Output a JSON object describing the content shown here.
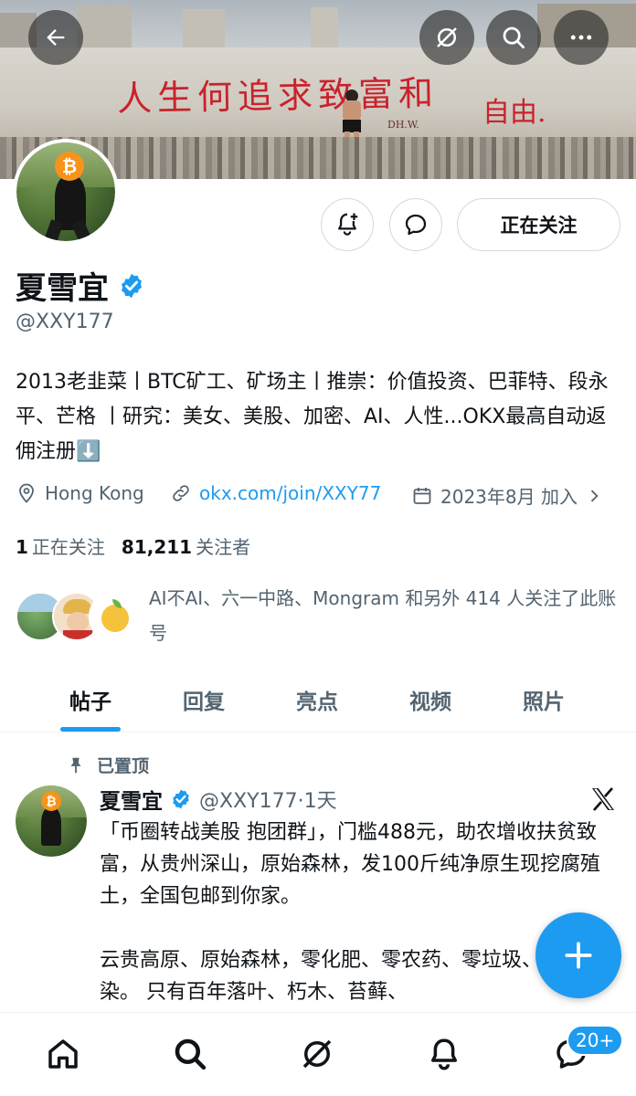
{
  "banner": {
    "slogan": "人生何追求致富和",
    "slogan_end": "自由.",
    "signature": "DH.W."
  },
  "header_icons": [
    "back-arrow-icon",
    "grok-icon",
    "search-icon",
    "more-icon"
  ],
  "profile": {
    "name": "夏雪宜",
    "handle": "@XXY177",
    "verified": true,
    "follow_button": "正在关注",
    "bio": "2013老韭菜丨BTC矿工、矿场主丨推崇：价值投资、巴菲特、段永平、芒格 丨研究：美女、美股、加密、AI、人性...OKX最高自动返佣注册⬇️",
    "location": "Hong Kong",
    "link": "okx.com/join/XXY77",
    "joined": "2023年8月 加入"
  },
  "stats": {
    "following_count": "1",
    "following_label": "正在关注",
    "followers_count": "81,211",
    "followers_label": "关注者"
  },
  "followed_by": "AI不AI、六一中路、Mongram 和另外 414 人关注了此账号",
  "tabs": [
    "帖子",
    "回复",
    "亮点",
    "视频",
    "照片"
  ],
  "active_tab": 0,
  "post": {
    "pinned_label": "已置顶",
    "author": "夏雪宜",
    "handle_time": "@XXY177·1天",
    "text": "「币圈转战美股 抱团群」，门槛488元，助农增收扶贫致富，从贵州深山，原始森林，发100斤纯净原生现挖腐殖土，全国包邮到你家。\n\n云贵高原、原始森林，零化肥、零农药、零垃圾、零金属污染。 只有百年落叶、朽木、苔藓、"
  },
  "bottom_nav": {
    "badge": "20+"
  },
  "colors": {
    "accent": "#1d9bf0",
    "text": "#0f1419",
    "secondary": "#536471",
    "btc": "#f7931a",
    "slogan": "#c8232c"
  }
}
